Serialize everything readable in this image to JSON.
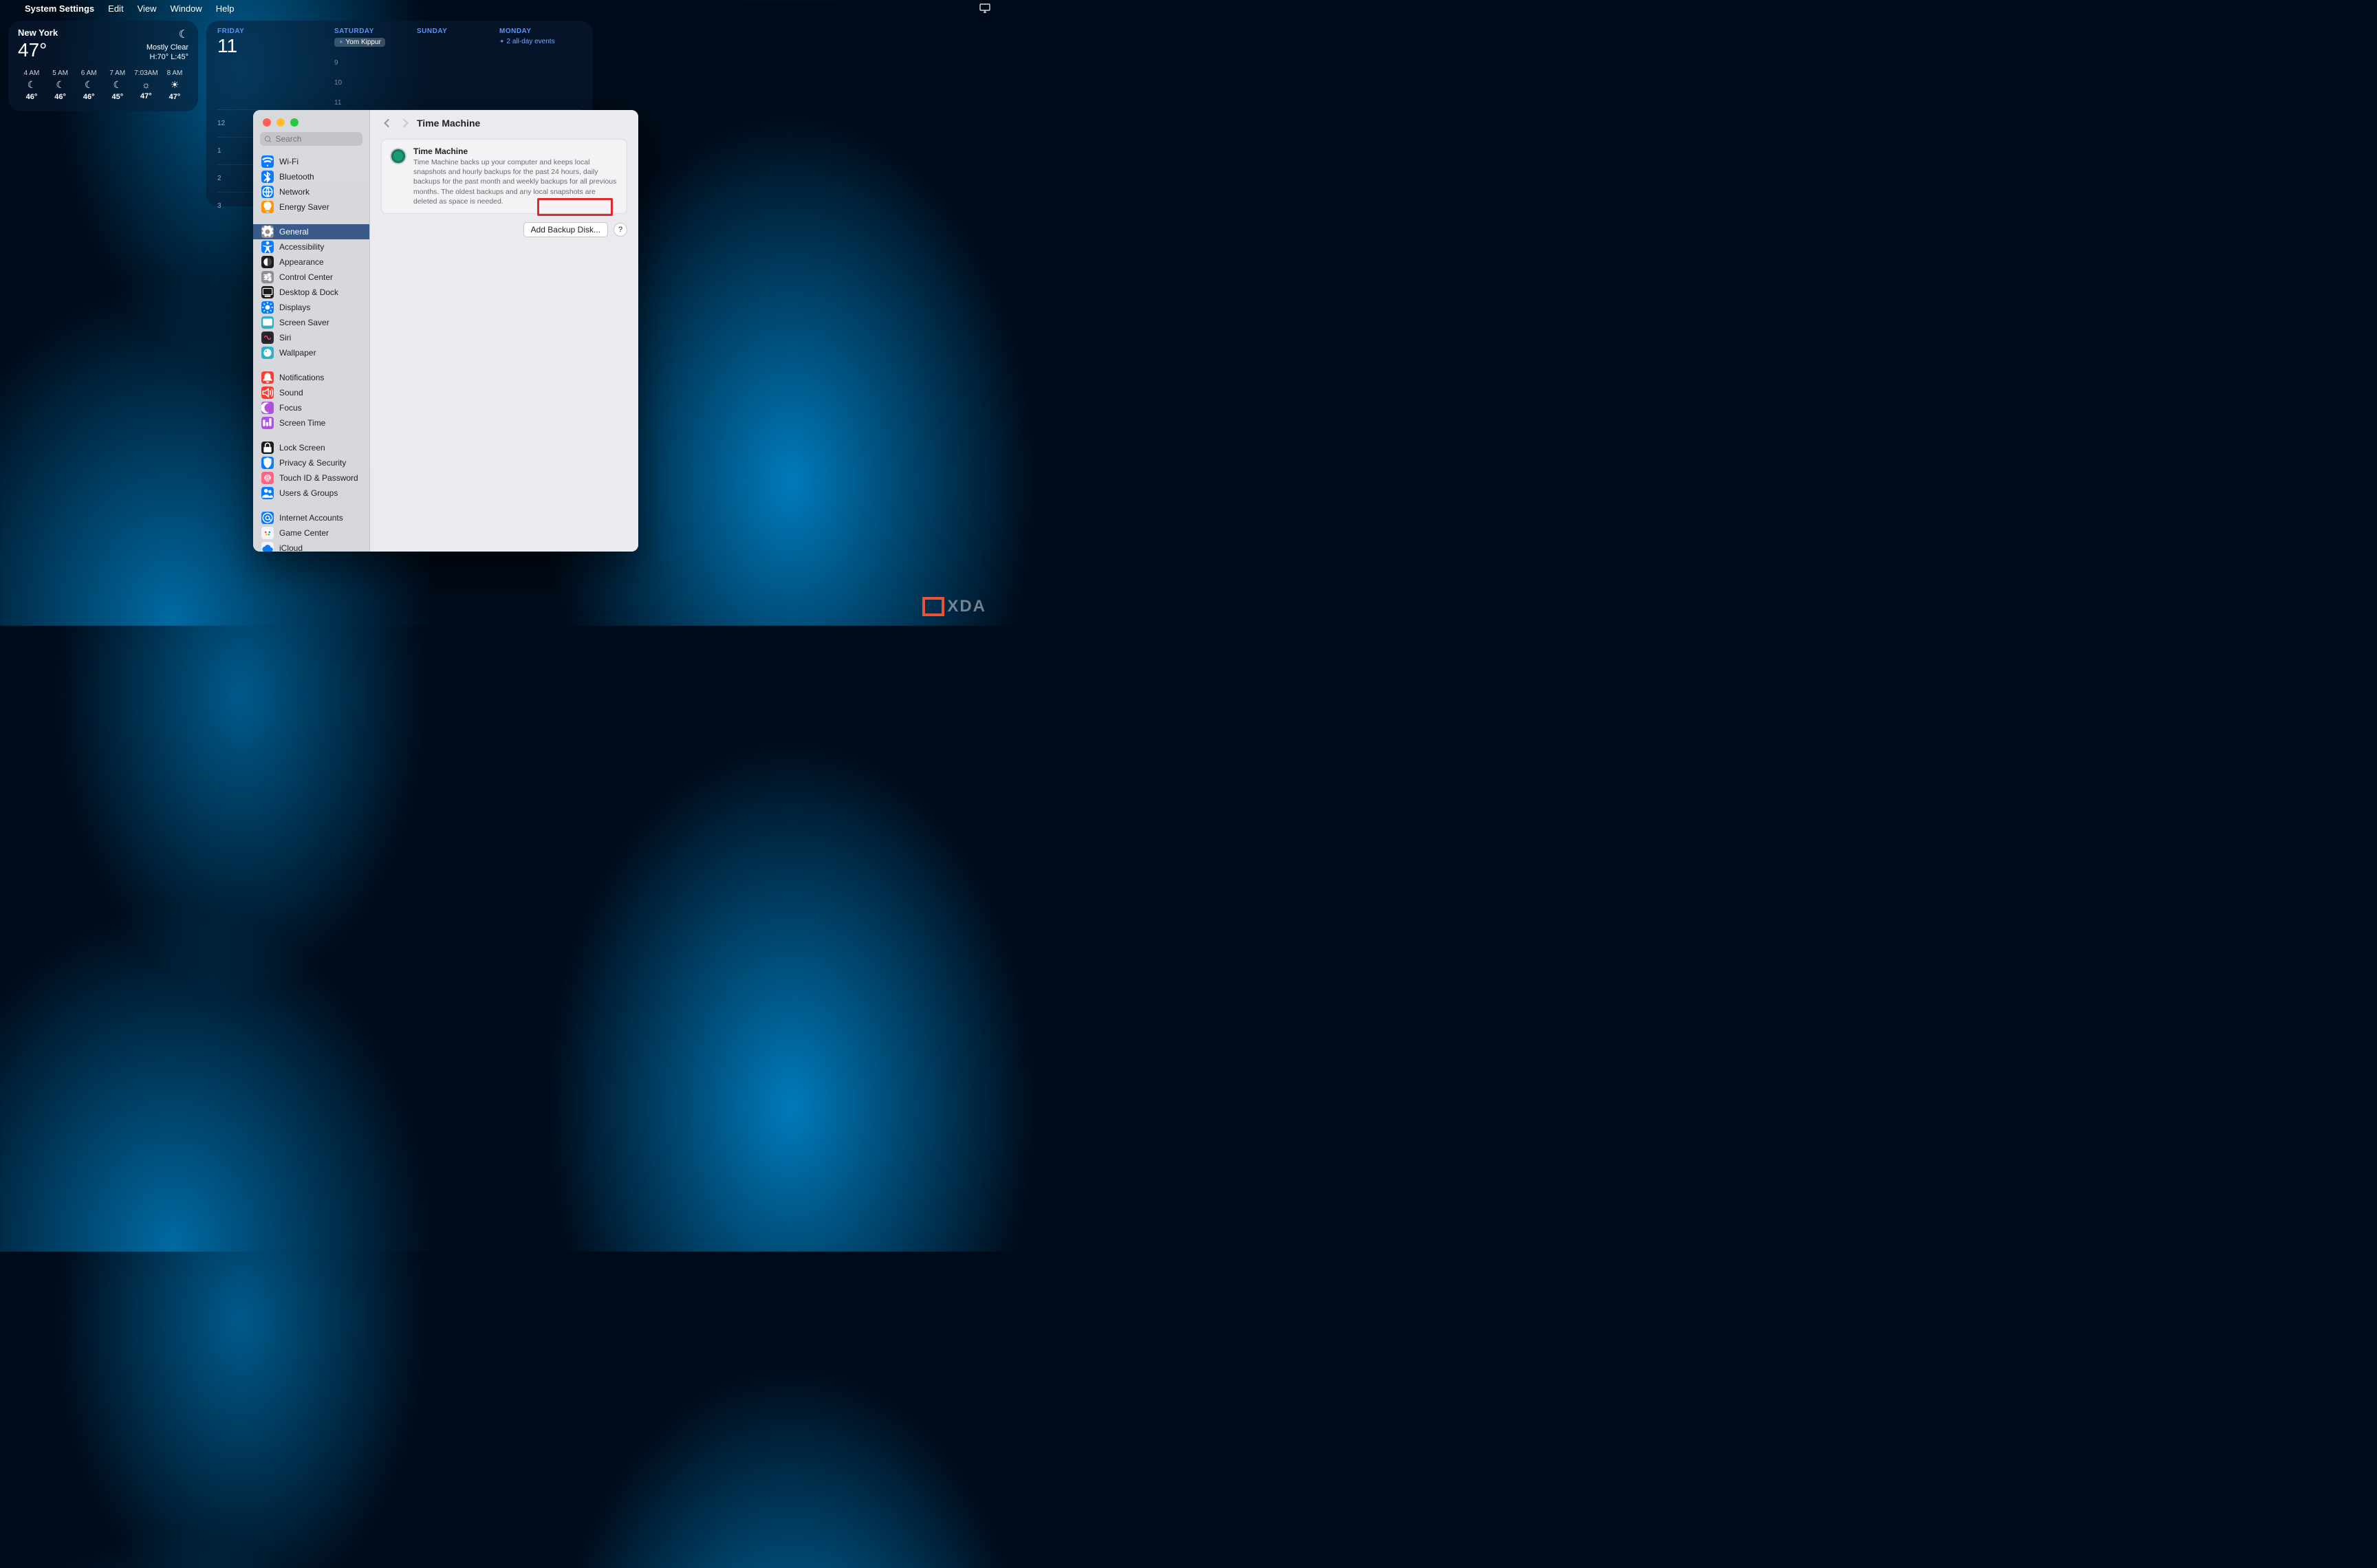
{
  "menubar": {
    "app": "System Settings",
    "items": [
      "Edit",
      "View",
      "Window",
      "Help"
    ]
  },
  "weather": {
    "city": "New York",
    "temp": "47°",
    "cond": "Mostly Clear",
    "hilo": "H:70° L:45°",
    "hours": [
      {
        "t": "4 AM",
        "deg": "46°"
      },
      {
        "t": "5 AM",
        "deg": "46°"
      },
      {
        "t": "6 AM",
        "deg": "46°"
      },
      {
        "t": "7 AM",
        "deg": "45°"
      },
      {
        "t": "7:03AM",
        "deg": "47°"
      },
      {
        "t": "8 AM",
        "deg": "47°"
      }
    ]
  },
  "calendar": {
    "days": [
      {
        "name": "FRIDAY",
        "num": "11"
      },
      {
        "name": "SATURDAY",
        "event_pill": "Yom Kippur"
      },
      {
        "name": "SUNDAY"
      },
      {
        "name": "MONDAY",
        "event_text": "2 all-day events"
      }
    ],
    "rows": [
      "12",
      "1",
      "2",
      "3"
    ],
    "marks": [
      "9",
      "10",
      "11"
    ]
  },
  "settings": {
    "search_placeholder": "Search",
    "title": "Time Machine",
    "card": {
      "title": "Time Machine",
      "desc": "Time Machine backs up your computer and keeps local snapshots and hourly backups for the past 24 hours, daily backups for the past month and weekly backups for all previous months. The oldest backups and any local snapshots are deleted as space is needed."
    },
    "add_button": "Add Backup Disk...",
    "help": "?",
    "sidebar": [
      {
        "label": "Wi-Fi",
        "color": "blue",
        "glyph": "wifi"
      },
      {
        "label": "Bluetooth",
        "color": "blue",
        "glyph": "bt"
      },
      {
        "label": "Network",
        "color": "blue",
        "glyph": "net"
      },
      {
        "label": "Energy Saver",
        "color": "orange",
        "glyph": "bulb"
      },
      {
        "gap": true
      },
      {
        "label": "General",
        "color": "gray",
        "glyph": "gear",
        "selected": true
      },
      {
        "label": "Accessibility",
        "color": "blue",
        "glyph": "acc"
      },
      {
        "label": "Appearance",
        "color": "black",
        "glyph": "app"
      },
      {
        "label": "Control Center",
        "color": "gray",
        "glyph": "cc"
      },
      {
        "label": "Desktop & Dock",
        "color": "black",
        "glyph": "dock"
      },
      {
        "label": "Displays",
        "color": "blue",
        "glyph": "disp"
      },
      {
        "label": "Screen Saver",
        "color": "teal",
        "glyph": "ss"
      },
      {
        "label": "Siri",
        "color": "dark",
        "glyph": "siri"
      },
      {
        "label": "Wallpaper",
        "color": "teal",
        "glyph": "wall"
      },
      {
        "gap": true
      },
      {
        "label": "Notifications",
        "color": "red2",
        "glyph": "bell"
      },
      {
        "label": "Sound",
        "color": "red2",
        "glyph": "snd"
      },
      {
        "label": "Focus",
        "color": "purple",
        "glyph": "moon"
      },
      {
        "label": "Screen Time",
        "color": "purple",
        "glyph": "st"
      },
      {
        "gap": true
      },
      {
        "label": "Lock Screen",
        "color": "black",
        "glyph": "lock"
      },
      {
        "label": "Privacy & Security",
        "color": "blue",
        "glyph": "hand"
      },
      {
        "label": "Touch ID & Password",
        "color": "pink",
        "glyph": "tid"
      },
      {
        "label": "Users & Groups",
        "color": "blue",
        "glyph": "usr"
      },
      {
        "gap": true
      },
      {
        "label": "Internet Accounts",
        "color": "blue",
        "glyph": "at"
      },
      {
        "label": "Game Center",
        "color": "white",
        "glyph": "gc"
      },
      {
        "label": "iCloud",
        "color": "white",
        "glyph": "cl"
      }
    ]
  },
  "watermark": "XDA"
}
